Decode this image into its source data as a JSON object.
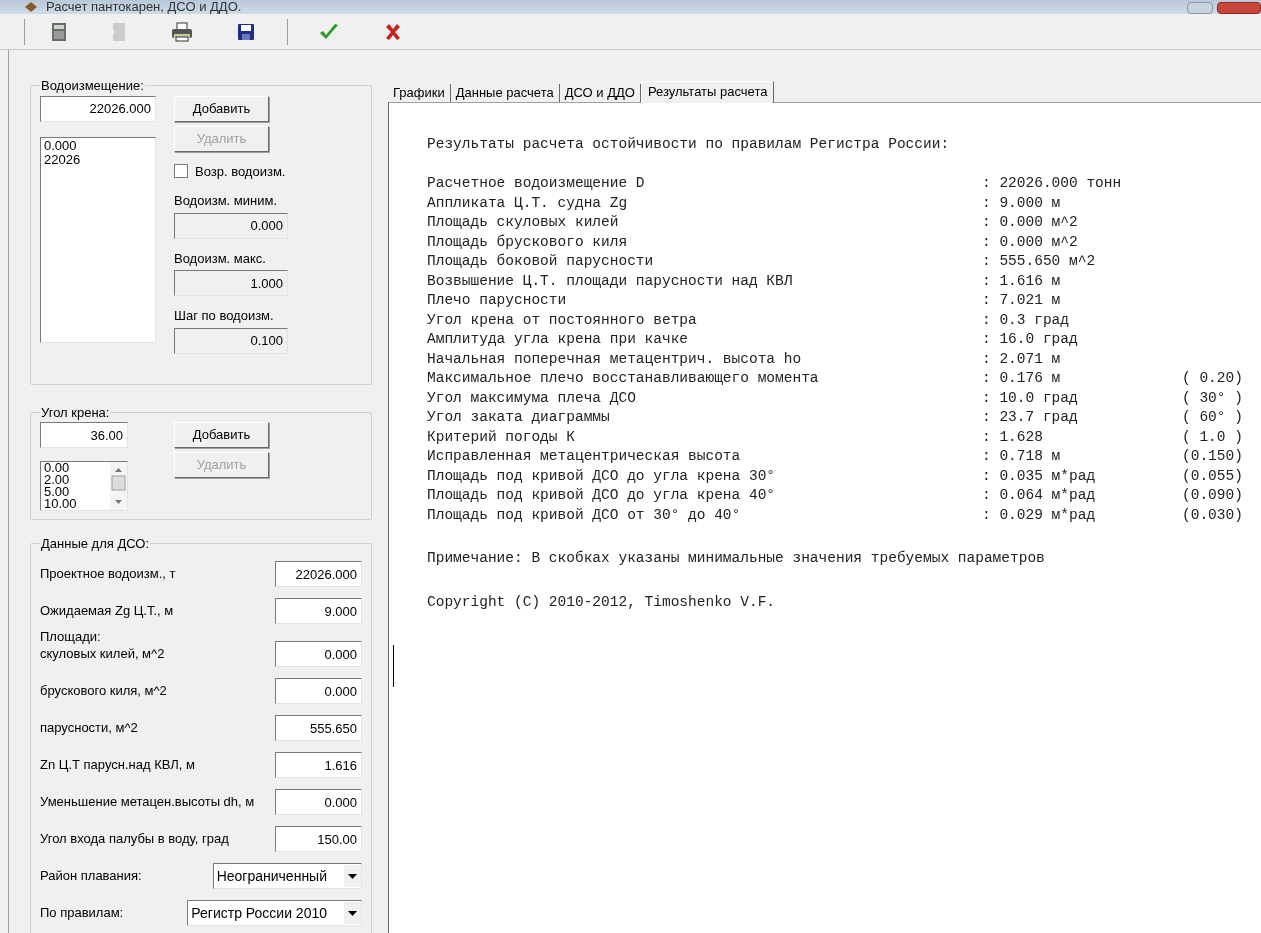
{
  "window": {
    "title": "Расчет пантокарен, ДСО и ДДО."
  },
  "toolbar": {
    "groups": [
      [
        {
          "kind": "calculator",
          "disabled": false
        },
        {
          "kind": "document",
          "disabled": true
        },
        {
          "kind": "printer",
          "disabled": false
        },
        {
          "kind": "save",
          "disabled": false
        }
      ],
      [
        {
          "kind": "accept",
          "disabled": false
        },
        {
          "kind": "cancel",
          "disabled": false
        }
      ]
    ]
  },
  "displacement": {
    "title": "Водоизмещение:",
    "input": "22026.000",
    "add_button": {
      "label": "Добавить",
      "disabled": false
    },
    "remove_button": {
      "label": "Удалить",
      "disabled": true
    },
    "list": [
      "0.000",
      "22026"
    ],
    "checkbox": {
      "label": "Возр. водоизм.",
      "checked": false
    },
    "fields": [
      {
        "label": "Водоизм. миним.",
        "value": "0.000",
        "disabled": true
      },
      {
        "label": "Водоизм. макс.",
        "value": "1.000",
        "disabled": true
      },
      {
        "label": "Шаг по водоизм.",
        "value": "0.100",
        "disabled": true
      }
    ]
  },
  "heel_angle": {
    "title": "Угол крена:",
    "input": "36.00",
    "add_button": {
      "label": "Добавить",
      "disabled": false
    },
    "remove_button": {
      "label": "Удалить",
      "disabled": true
    },
    "list": [
      "0.00",
      "2.00",
      "5.00",
      "10.00"
    ]
  },
  "dso_data": {
    "title": "Данные для ДСО:",
    "rows": [
      {
        "kind": "field",
        "label": "Проектное водоизм., т",
        "value": "22026.000"
      },
      {
        "kind": "field",
        "label": "Ожидаемая Zg Ц.Т., м",
        "value": "9.000"
      },
      {
        "kind": "heading",
        "label": "Площади:"
      },
      {
        "kind": "field",
        "label": "скуловых килей, м^2",
        "value": "0.000"
      },
      {
        "kind": "field",
        "label": "брускового киля, м^2",
        "value": "0.000"
      },
      {
        "kind": "field",
        "label": "парусности, м^2",
        "value": "555.650"
      },
      {
        "kind": "field",
        "label": "Zn Ц.Т парусн.над КВЛ, м",
        "value": "1.616"
      },
      {
        "kind": "field",
        "label": "Уменьшение метацен.высоты dh, м",
        "value": "0.000"
      },
      {
        "kind": "field",
        "label": "Угол входа палубы в воду, град",
        "value": "150.00"
      },
      {
        "kind": "select",
        "label": "Район плавания:",
        "value": "Неограниченный"
      },
      {
        "kind": "select",
        "label": "По правилам:",
        "value": "Регистр России 2010"
      }
    ]
  },
  "tabs": [
    {
      "label": "Графики",
      "selected": false
    },
    {
      "label": "Данные расчета",
      "selected": false
    },
    {
      "label": "ДСО и ДДО",
      "selected": false
    },
    {
      "label": "Результаты расчета",
      "selected": true
    }
  ],
  "results": {
    "title": "Результаты расчета остойчивости по правилам Регистра России:",
    "rows": [
      {
        "label": "Расчетное водоизмещение D",
        "value": ": 22026.000 тонн"
      },
      {
        "label": "Аппликата Ц.Т. судна Zg",
        "value": ": 9.000 м"
      },
      {
        "label": "Площадь скуловых килей",
        "value": ": 0.000 м^2"
      },
      {
        "label": "Площадь брускового киля",
        "value": ": 0.000 м^2"
      },
      {
        "label": "Площадь боковой парусности",
        "value": ": 555.650 м^2"
      },
      {
        "label": "Возвышение Ц.Т. площади парусности над КВЛ",
        "value": ": 1.616 м"
      },
      {
        "label": "Плечо парусности",
        "value": ": 7.021 м"
      },
      {
        "label": "Угол крена от постоянного ветра",
        "value": ": 0.3 град"
      },
      {
        "label": "Амплитуда угла крена при качке",
        "value": ": 16.0 град"
      },
      {
        "label": "Начальная поперечная метацентрич. высота ho",
        "value": ": 2.071 м"
      },
      {
        "label": "Максимальное плечо восстанавливающего момента",
        "value": ": 0.176 м",
        "min": "( 0.20)"
      },
      {
        "label": "Угол максимума плеча ДСО",
        "value": ": 10.0 град",
        "min": "( 30° )"
      },
      {
        "label": "Угол заката диаграммы",
        "value": ": 23.7 град",
        "min": "( 60° )"
      },
      {
        "label": "Критерий погоды К",
        "value": ": 1.628",
        "min": "( 1.0 )"
      },
      {
        "label": "Исправленная метацентрическая высота",
        "value": ": 0.718 м",
        "min": "(0.150)"
      },
      {
        "label": "Площадь под кривой ДСО до угла крена 30°",
        "value": ": 0.035 м*рад",
        "min": "(0.055)"
      },
      {
        "label": "Площадь под кривой ДСО до угла крена 40°",
        "value": ": 0.064 м*рад",
        "min": "(0.090)"
      },
      {
        "label": "Площадь под кривой ДСО от 30° до 40°",
        "value": ": 0.029 м*рад",
        "min": "(0.030)"
      }
    ],
    "note": "Примечание: В скобках указаны минимальные значения требуемых параметров",
    "copyright": "Copyright (C) 2010-2012, Timoshenko V.F."
  }
}
